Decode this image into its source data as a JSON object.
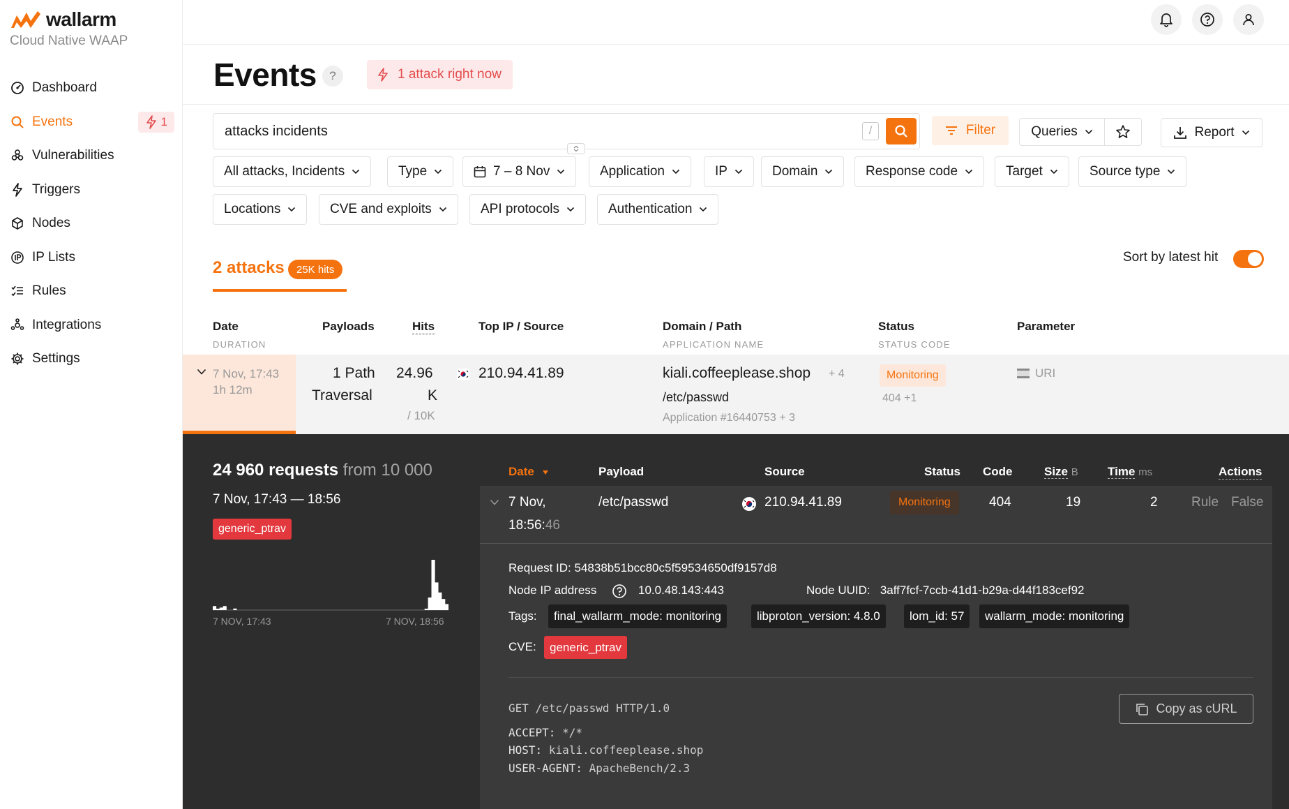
{
  "brand": {
    "name": "wallarm",
    "subtitle": "Cloud Native WAAP"
  },
  "sidebar": {
    "items": [
      {
        "label": "Dashboard",
        "icon": "dashboard-icon"
      },
      {
        "label": "Events",
        "icon": "search-icon",
        "active": true,
        "badge": "1"
      },
      {
        "label": "Vulnerabilities",
        "icon": "biohazard-icon"
      },
      {
        "label": "Triggers",
        "icon": "lightning-icon"
      },
      {
        "label": "Nodes",
        "icon": "cube-icon"
      },
      {
        "label": "IP Lists",
        "icon": "ip-icon"
      },
      {
        "label": "Rules",
        "icon": "rules-icon"
      },
      {
        "label": "Integrations",
        "icon": "integrations-icon"
      },
      {
        "label": "Settings",
        "icon": "gear-icon"
      }
    ]
  },
  "header": {
    "title": "Events",
    "attack_now": "1 attack right now"
  },
  "search": {
    "value": "attacks incidents",
    "shortcut": "/"
  },
  "toolbar": {
    "filter_label": "Filter",
    "queries_label": "Queries",
    "report_label": "Report"
  },
  "filters": {
    "row1": [
      "All attacks, Incidents",
      "Type",
      "7 – 8 Nov",
      "Application",
      "IP",
      "Domain",
      "Response code",
      "Target",
      "Source type"
    ],
    "row2": [
      "Locations",
      "CVE and exploits",
      "API protocols",
      "Authentication"
    ]
  },
  "summary": {
    "attacks": "2 attacks",
    "hits": "25K hits",
    "sort_label": "Sort by latest hit"
  },
  "table": {
    "headers": {
      "date": "Date",
      "date_sub": "DURATION",
      "payloads": "Payloads",
      "hits": "Hits",
      "top_ip": "Top IP / Source",
      "domain": "Domain / Path",
      "domain_sub": "APPLICATION NAME",
      "status": "Status",
      "status_sub": "STATUS CODE",
      "parameter": "Parameter"
    },
    "row": {
      "date": "7 Nov, 17:43",
      "duration": "1h 12m",
      "payload_line1": "1 Path",
      "payload_line2": "Traversal",
      "hits_line1": "24.96",
      "hits_line2": "K",
      "hits_sub": "/ 10K",
      "ip": "210.94.41.89",
      "domain": "kiali.coffeeplease.shop",
      "domain_more": "+ 4",
      "path": "/etc/passwd",
      "app": "Application #16440753 + 3",
      "status": "Monitoring",
      "status_code": "404 +1",
      "parameter": "URI"
    }
  },
  "details": {
    "requests_count": "24 960 requests",
    "requests_from": "from 10 000",
    "range": "7 Nov, 17:43 — 18:56",
    "tag": "generic_ptrav",
    "hist_start": "7 NOV, 17:43",
    "hist_end": "7 NOV, 18:56",
    "hist_bins": [
      0.08,
      0.02,
      0.05,
      0.08,
      0,
      0,
      0.03,
      0,
      0,
      0,
      0,
      0,
      0,
      0,
      0,
      0,
      0,
      0,
      0,
      0,
      0,
      0,
      0,
      0,
      0,
      0,
      0,
      0,
      0,
      0,
      0,
      0,
      0,
      0,
      0,
      0,
      0,
      0,
      0,
      0,
      0,
      0,
      0,
      0,
      0,
      0,
      0,
      0,
      0,
      0,
      0,
      0,
      0,
      0,
      0,
      0,
      0,
      0,
      0,
      0,
      0,
      0,
      0.02,
      0.25,
      1.0,
      0.55,
      0.35,
      0.22,
      0.12
    ]
  },
  "requests": {
    "headers": {
      "date": "Date",
      "payload": "Payload",
      "source": "Source",
      "status": "Status",
      "code": "Code",
      "size": "Size",
      "size_unit": "B",
      "time": "Time",
      "time_unit": "ms",
      "actions": "Actions"
    },
    "row": {
      "date": "7 Nov,",
      "time_main": "18:56:",
      "time_sec": "46",
      "payload": "/etc/passwd",
      "source": "210.94.41.89",
      "status": "Monitoring",
      "code": "404",
      "size": "19",
      "time": "2",
      "action_rule": "Rule",
      "action_false": "False"
    },
    "request_id_label": "Request ID:",
    "request_id": "54838b51bcc80c5f59534650df9157d8",
    "node_ip_label": "Node IP address",
    "node_ip": "10.0.48.143:443",
    "node_uuid_label": "Node UUID:",
    "node_uuid": "3aff7fcf-7ccb-41d1-b29a-d44f183cef92",
    "tags_label": "Tags:",
    "tags": [
      "final_wallarm_mode: monitoring",
      "libproton_version: 4.8.0",
      "lom_id: 57",
      "wallarm_mode: monitoring"
    ],
    "cve_label": "CVE:",
    "cve": "generic_ptrav",
    "http_line": "GET /etc/passwd HTTP/1.0",
    "http_headers": [
      {
        "key": "ACCEPT:",
        "value": "*/*"
      },
      {
        "key": "HOST:",
        "value": "kiali.coffeeplease.shop"
      },
      {
        "key": "USER-AGENT:",
        "value": "ApacheBench/2.3"
      }
    ],
    "copy_curl_label": "Copy as cURL"
  },
  "colors": {
    "accent": "#f5730f",
    "danger": "#e3383d",
    "dark_panel": "#2d2d2d"
  }
}
